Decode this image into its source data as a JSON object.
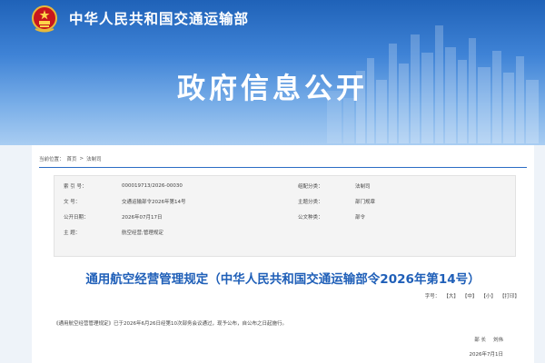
{
  "header": {
    "ministry_name": "中华人民共和国交通运输部",
    "page_title": "政府信息公开"
  },
  "breadcrumb": {
    "prefix": "当前位置：",
    "items": [
      "首页",
      "法制司"
    ],
    "separator": ">"
  },
  "meta": {
    "rows": [
      {
        "label": "索 引 号：",
        "value": "000019713/2026-00030",
        "label2": "组配分类：",
        "value2": "法制司"
      },
      {
        "label": "文    号：",
        "value": "交通运输部令2026年第14号",
        "label2": "主题分类：",
        "value2": "部门规章"
      },
      {
        "label": "公开日期：",
        "value": "2026年07月17日",
        "label2": "公文种类：",
        "value2": "部令"
      },
      {
        "label": "主    题：",
        "value": "航空经营;管理规定",
        "label2": "",
        "value2": ""
      }
    ]
  },
  "document": {
    "title": "通用航空经营管理规定（中华人民共和国交通运输部令2026年第14号）",
    "font_size_label": "字号：",
    "font_sizes": [
      "大",
      "中",
      "小"
    ],
    "print_label": "打印",
    "body_first_line": "《通用航空经营管理规定》已于2026年6月26日经第10次部务会议通过，现予公布，自公布之日起施行。",
    "signer_title": "部  长",
    "signer_name": "刘伟",
    "date": "2026年7月1日"
  },
  "colors": {
    "banner_top": "#1f62b8",
    "title_blue": "#1f5fb8",
    "rule_blue": "#2b6cc4"
  }
}
